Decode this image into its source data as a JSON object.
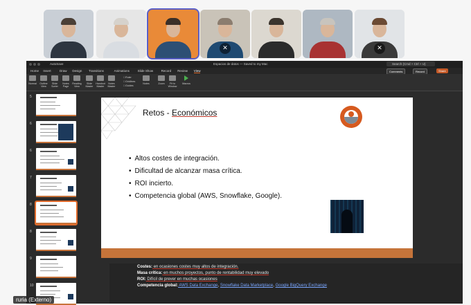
{
  "participants": [
    {
      "name": "participant-1",
      "muted": false,
      "active": false,
      "bg": "#c9cfd6",
      "shirt": "#2d3540",
      "hair": "#4a3f36"
    },
    {
      "name": "participant-2",
      "muted": false,
      "active": false,
      "bg": "#e6e6e6",
      "shirt": "#d9dde2",
      "hair": "#d6d2cc"
    },
    {
      "name": "participant-3",
      "muted": false,
      "active": true,
      "bg": "#e98a38",
      "shirt": "#2d4f74",
      "hair": "#3a2f28"
    },
    {
      "name": "participant-4",
      "muted": true,
      "active": false,
      "bg": "#c9c3b8",
      "shirt": "#1f4a72",
      "hair": "#8b7d6f"
    },
    {
      "name": "participant-5",
      "muted": false,
      "active": false,
      "bg": "#dcd8d0",
      "shirt": "#2b2b2b",
      "hair": "#3b342d"
    },
    {
      "name": "participant-6",
      "muted": false,
      "active": false,
      "bg": "#aeb8c2",
      "shirt": "#a83232",
      "hair": "#c8c4bd"
    },
    {
      "name": "participant-7",
      "muted": true,
      "active": false,
      "bg": "#e1e4e7",
      "shirt": "#3a3a3a",
      "hair": "#6b4a33"
    }
  ],
  "ppt": {
    "autosave": "AutoSave",
    "doc_title": "Espacios de datos — Saved to my Mac",
    "search": "Search (Cmd + Ctrl + U)",
    "menu": [
      "Home",
      "Insert",
      "Draw",
      "Design",
      "Transitions",
      "Animations",
      "Slide Show",
      "Record",
      "Review",
      "View"
    ],
    "menu_selected": "View",
    "comments": "Comments",
    "record": "Record",
    "share": "Share",
    "ribbon": [
      {
        "label": "Normal"
      },
      {
        "label": "Outline View"
      },
      {
        "label": "Slide Sorter"
      },
      {
        "label": "Notes Page"
      },
      {
        "label": "Reading View"
      },
      {
        "label": "Slide Master"
      },
      {
        "label": "Handout Master"
      },
      {
        "label": "Notes Master"
      }
    ],
    "ribbon_checks": [
      "Ruler",
      "Gridlines",
      "Guides"
    ],
    "ribbon_right": [
      {
        "label": "Notes"
      },
      {
        "label": "Zoom"
      },
      {
        "label": "Fit to Window"
      },
      {
        "label": "Macros"
      }
    ]
  },
  "slides": {
    "numbers": [
      "5",
      "6",
      "6",
      "7",
      "8",
      "8",
      "9",
      "10"
    ],
    "selected_index": 4
  },
  "slide": {
    "title_plain": "Retos - ",
    "title_underlined": "Económicos",
    "bullets": [
      "Altos costes de integración.",
      "Dificultad de alcanzar masa crítica.",
      "ROI incierto.",
      "Competencia global (AWS, Snowflake, Google)."
    ]
  },
  "notes": {
    "l1_head": "Costes:",
    "l1_text": " en ocasiones costes muy altos de integración.",
    "l2_head": "Masa crítica:",
    "l2_text": " en muchos proyectos, punto de rentabilidad muy elevado",
    "l3_head": "ROI:",
    "l3_text": " Difícil de prever en muchas ocasiones",
    "l4_head": "Competencia global:",
    "l4_link1": " AWS Data Exchange",
    "l4_sep1": ", ",
    "l4_link2": "Snowflake Data Marketplace",
    "l4_sep2": ", ",
    "l4_link3": "Google BigQuery Exchange"
  },
  "presenter_label": "ruria (Externo)"
}
